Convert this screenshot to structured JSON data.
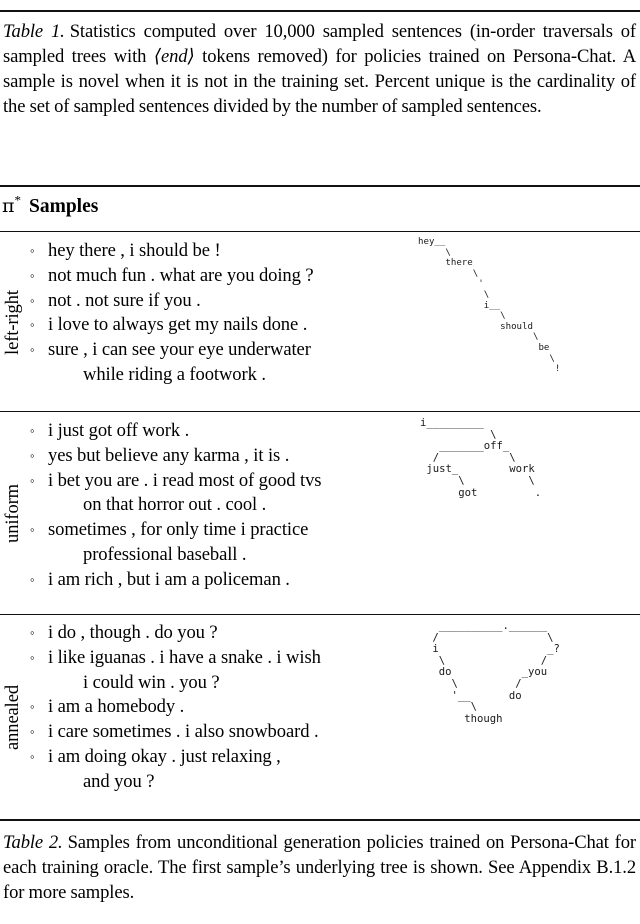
{
  "caption_top": {
    "label": "Table 1.",
    "text_part1": "Statistics computed over 10,000 sampled sentences (in-order traversals of sampled trees with ",
    "math_token": "⟨end⟩",
    "text_part2": " tokens removed) for policies trained on Persona-Chat. A sample is novel when it is not in the training set. Percent unique is the cardinality of the set of sampled sentences divided by the number of sampled sentences."
  },
  "caption_bottom": {
    "label": "Table 2.",
    "text": "Samples from unconditional generation policies trained on Persona-Chat for each training oracle. The first sample’s underlying tree is shown. See Appendix B.1.2 for more samples."
  },
  "table": {
    "header": {
      "policy_symbol": "π",
      "policy_superscript": "*",
      "samples_label": "Samples"
    },
    "sections": [
      {
        "row_label": "left-right",
        "samples": [
          {
            "line1": "hey there , i should be !",
            "line2": ""
          },
          {
            "line1": "not much fun . what are you doing ?",
            "line2": ""
          },
          {
            "line1": "not . not sure if you .",
            "line2": ""
          },
          {
            "line1": "i love to always get my nails done .",
            "line2": ""
          },
          {
            "line1": "sure , i can see your eye underwater",
            "line2": "while riding a footwork ."
          }
        ],
        "tree_ascii": "hey__\n     \\\n     there\n          \\\n           '\n            \\\n            i__\n               \\\n               should\n                     \\\n                      be\n                        \\\n                         !"
      },
      {
        "row_label": "uniform",
        "samples": [
          {
            "line1": "i just got off work .",
            "line2": ""
          },
          {
            "line1": "yes but believe any karma , it is .",
            "line2": ""
          },
          {
            "line1": "i bet you are . i read most of good tvs",
            "line2": "on that horror out . cool ."
          },
          {
            "line1": "sometimes , for only time i practice",
            "line2": "professional baseball ."
          },
          {
            "line1": "i am rich , but i am a policeman .",
            "line2": ""
          }
        ],
        "tree_ascii": "i_________\n           \\\n   _______off_\n  /           \\\n just_        work\n      \\          \\\n      got         ."
      },
      {
        "row_label": "annealed",
        "samples": [
          {
            "line1": "i do , though . do you ?",
            "line2": ""
          },
          {
            "line1": "i like iguanas . i have a snake . i wish",
            "line2": "i could win . you ?"
          },
          {
            "line1": "i am a homebody .",
            "line2": ""
          },
          {
            "line1": "i care sometimes . i also snowboard .",
            "line2": ""
          },
          {
            "line1": "i am doing okay . just relaxing ,",
            "line2": "and you ?"
          }
        ],
        "tree_ascii": "  __________.______\n /                 \\\n i                 _?\n  \\               /\n  do           _you\n    \\         /\n    '__      do\n       \\\n      though"
      }
    ]
  },
  "colors": {
    "rule": "#111111",
    "text": "#000000",
    "tree": "#1a1a1a"
  }
}
